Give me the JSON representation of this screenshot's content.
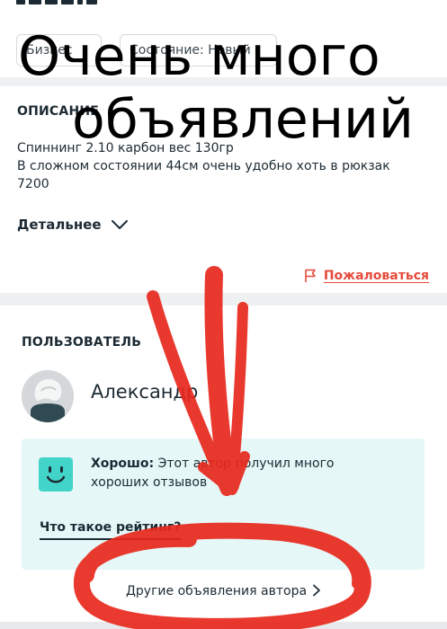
{
  "chips": {
    "business": "Бизнес",
    "condition": "Состояние: Новый"
  },
  "description": {
    "heading": "ОПИСАНИЕ",
    "lines": [
      "Спиннинг 2.10 карбон вес 130гр",
      "В сложном состоянии 44см очень удобно хоть в рюкзак",
      "7200"
    ],
    "details_label": "Детальнее",
    "report_label": "Пожаловаться"
  },
  "user": {
    "heading": "ПОЛЬЗОВАТЕЛЬ",
    "name": "Александр",
    "rating": {
      "title": "Хорошо:",
      "text": " Этот автор получил много хороших отзывов",
      "link": "Что такое рейтинг?"
    },
    "other_ads_label": "Другие объявления автора"
  },
  "overlay": {
    "line1": "Очень много",
    "line2": "объявлений"
  },
  "colors": {
    "accent_red": "#e64b3c",
    "annotation_red": "#e8281c",
    "rating_bg": "#e6f7f8",
    "smile": "#43d4c9"
  },
  "icons": {
    "details": "chevron-down-icon",
    "report": "flag-icon",
    "other_ads": "chevron-right-icon",
    "rating": "smile-icon"
  }
}
